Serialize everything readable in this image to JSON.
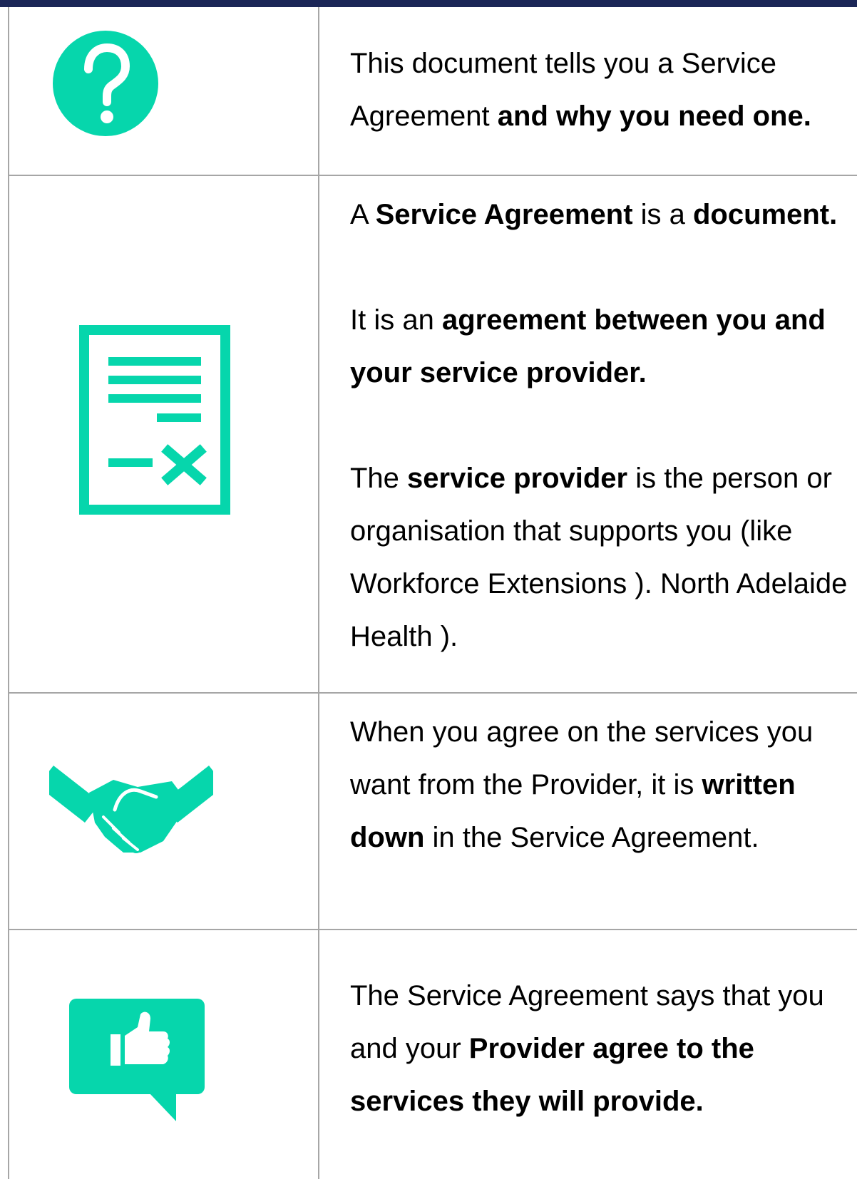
{
  "colors": {
    "accent": "#06d6ac",
    "top_bar": "#1b2657",
    "grid_lines": "#a6a6a6"
  },
  "rows": [
    {
      "icon": "question-mark-icon",
      "paragraphs": [
        [
          {
            "text": "This document tells you a Service Agreement ",
            "bold": false
          },
          {
            "text": "and why you need one.",
            "bold": true
          }
        ]
      ]
    },
    {
      "icon": "document-icon",
      "paragraphs": [
        [
          {
            "text": "A ",
            "bold": false
          },
          {
            "text": "Service Agreement",
            "bold": true
          },
          {
            "text": " is a ",
            "bold": false
          },
          {
            "text": "document.",
            "bold": true
          }
        ],
        [
          {
            "text": "It is an ",
            "bold": false
          },
          {
            "text": "agreement between you and your service provider.",
            "bold": true
          }
        ],
        [
          {
            "text": "The ",
            "bold": false
          },
          {
            "text": "service provider",
            "bold": true
          },
          {
            "text": " is the person or organisation that supports you (like Workforce Extensions ). North Adelaide Health ).",
            "bold": false
          }
        ]
      ]
    },
    {
      "icon": "handshake-icon",
      "paragraphs": [
        [
          {
            "text": "When you agree on the services you want from the Provider, it is ",
            "bold": false
          },
          {
            "text": "written down",
            "bold": true
          },
          {
            "text": " in the Service Agreement.",
            "bold": false
          }
        ]
      ]
    },
    {
      "icon": "thumbs-up-speech-bubble-icon",
      "paragraphs": [
        [
          {
            "text": "The Service Agreement says that you and your ",
            "bold": false
          },
          {
            "text": "Provider agree to the services they will provide.",
            "bold": true
          }
        ]
      ]
    }
  ]
}
